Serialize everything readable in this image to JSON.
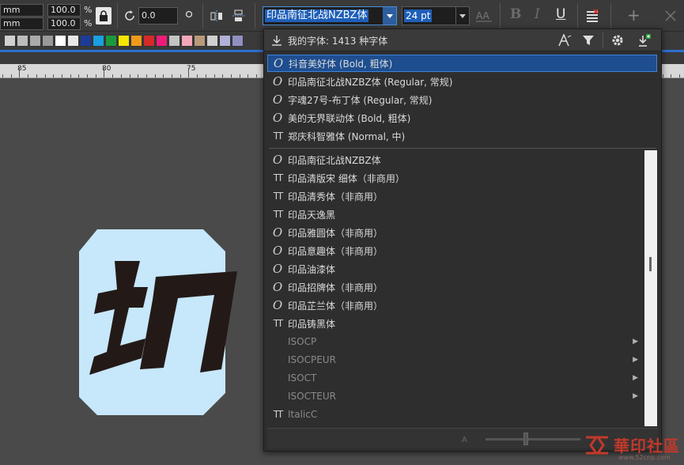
{
  "toolbar": {
    "unit_mm": "mm",
    "scale_x": "100.0",
    "scale_y": "100.0",
    "percent": "%",
    "rotation": "0.0",
    "font_name": "印品南征北战NZBZ体",
    "font_size": "24 pt",
    "bold": "B",
    "italic": "I",
    "underline": "U",
    "plus": "+"
  },
  "ruler": {
    "labels": [
      "85",
      "80",
      "75"
    ]
  },
  "palette": {
    "colors": [
      "#d0d0d0",
      "#bcbcbc",
      "#aaaaaa",
      "#999999",
      "#ffffff",
      "#e8e8e8",
      "#1d3c9a",
      "#1aa0e0",
      "#1b9a3c",
      "#f5e600",
      "#f09a1a",
      "#d42a2a",
      "#ee1c78",
      "#c4c4c4",
      "#f2a8b8",
      "#b89a7a",
      "#d0d0d0",
      "#b0b0d8",
      "#9090c0"
    ]
  },
  "dropdown": {
    "title": "我的字体: 1413 种字体",
    "recent": [
      {
        "label": "抖音美好体 (Bold, 粗体)",
        "icon": "O"
      },
      {
        "label": "印品南征北战NZBZ体 (Regular, 常规)",
        "icon": "O"
      },
      {
        "label": "字魂27号-布丁体 (Regular, 常规)",
        "icon": "O"
      },
      {
        "label": "美的无界联动体 (Bold, 粗体)",
        "icon": "O"
      },
      {
        "label": "郑庆科智雅体 (Normal, 中)",
        "icon": "TT"
      }
    ],
    "all": [
      {
        "label": "印品南征北战NZBZ体",
        "icon": "O"
      },
      {
        "label": "印品清版宋 细体（非商用）",
        "icon": "TT"
      },
      {
        "label": "印品清秀体（非商用）",
        "icon": "TT"
      },
      {
        "label": "印品天逸黑",
        "icon": "TT"
      },
      {
        "label": "印品雅圆体（非商用）",
        "icon": "O"
      },
      {
        "label": "印品意趣体（非商用）",
        "icon": "O"
      },
      {
        "label": "印品油漆体",
        "icon": "O"
      },
      {
        "label": "印品招牌体（非商用）",
        "icon": "O"
      },
      {
        "label": "印品芷兰体（非商用）",
        "icon": "O"
      },
      {
        "label": "印品铸黑体",
        "icon": "TT"
      },
      {
        "label": "ISOCP",
        "icon": ""
      },
      {
        "label": "ISOCPEUR",
        "icon": ""
      },
      {
        "label": "ISOCT",
        "icon": ""
      },
      {
        "label": "ISOCTEUR",
        "icon": ""
      },
      {
        "label": "ItalicC",
        "icon": "TT"
      }
    ]
  },
  "canvas": {
    "glyph_bg": "#c7e7fa",
    "glyph_fg": "#231a18"
  },
  "watermark": {
    "text": "華印社區",
    "site": "www.52cnp.com"
  }
}
